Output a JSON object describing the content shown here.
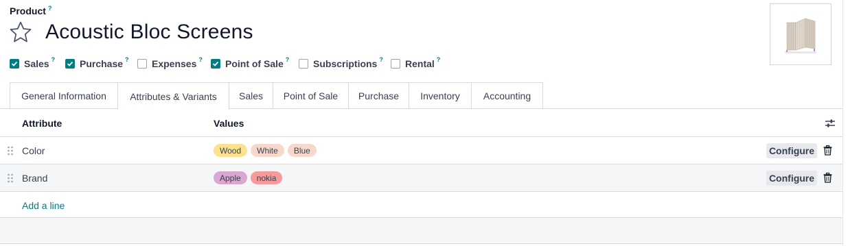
{
  "header": {
    "label": "Product",
    "label_help": "?",
    "title": "Acoustic Bloc Screens",
    "favorite_icon": "star-icon",
    "image_alt": "product-image"
  },
  "options": [
    {
      "label": "Sales",
      "help": "?",
      "checked": true
    },
    {
      "label": "Purchase",
      "help": "?",
      "checked": true
    },
    {
      "label": "Expenses",
      "help": "?",
      "checked": false
    },
    {
      "label": "Point of Sale",
      "help": "?",
      "checked": true
    },
    {
      "label": "Subscriptions",
      "help": "?",
      "checked": false
    },
    {
      "label": "Rental",
      "help": "?",
      "checked": false
    }
  ],
  "tabs": [
    {
      "label": "General Information",
      "active": false
    },
    {
      "label": "Attributes & Variants",
      "active": true
    },
    {
      "label": "Sales",
      "active": false
    },
    {
      "label": "Point of Sale",
      "active": false
    },
    {
      "label": "Purchase",
      "active": false
    },
    {
      "label": "Inventory",
      "active": false
    },
    {
      "label": "Accounting",
      "active": false
    }
  ],
  "table": {
    "columns": {
      "attribute": "Attribute",
      "values": "Values"
    },
    "rows": [
      {
        "attribute": "Color",
        "values": [
          {
            "label": "Wood",
            "color": "#fce28f"
          },
          {
            "label": "White",
            "color": "#f7d9cb"
          },
          {
            "label": "Blue",
            "color": "#f7d9cb"
          }
        ],
        "action": "Configure"
      },
      {
        "attribute": "Brand",
        "values": [
          {
            "label": "Apple",
            "color": "#d9a7d1"
          },
          {
            "label": "nokia",
            "color": "#f59b9b"
          }
        ],
        "action": "Configure"
      }
    ],
    "add_line": "Add a line"
  },
  "colors": {
    "accent": "#017e84",
    "border": "#d8dadd",
    "button_bg": "#e7e9ed"
  }
}
